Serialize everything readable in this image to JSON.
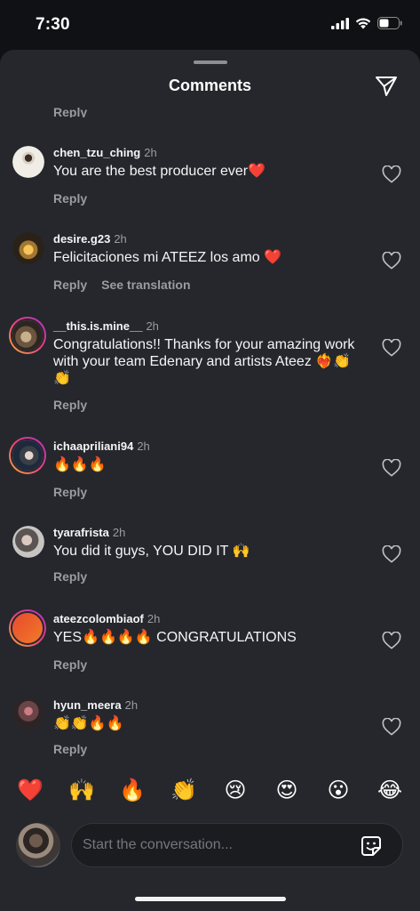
{
  "status": {
    "time": "7:30"
  },
  "header": {
    "title": "Comments"
  },
  "partial_reply": "Reply",
  "comments": [
    {
      "username": "chen_tzu_ching",
      "time": "2h",
      "text": "You are the best producer ever❤️",
      "reply": "Reply",
      "translate": ""
    },
    {
      "username": "desire.g23",
      "time": "2h",
      "text": "Felicitaciones mi ATEEZ los amo ❤️",
      "reply": "Reply",
      "translate": "See translation"
    },
    {
      "username": "__this.is.mine__",
      "time": "2h",
      "text": "Congratulations!! Thanks for your amazing work with your team Edenary and artists Ateez ❤️‍🔥👏👏",
      "reply": "Reply",
      "translate": ""
    },
    {
      "username": "ichaapriliani94",
      "time": "2h",
      "text": "🔥🔥🔥",
      "reply": "Reply",
      "translate": ""
    },
    {
      "username": "tyarafrista",
      "time": "2h",
      "text": "You did it guys, YOU DID IT 🙌",
      "reply": "Reply",
      "translate": ""
    },
    {
      "username": "ateezcolombiaof",
      "time": "2h",
      "text": "YES🔥🔥🔥🔥 CONGRATULATIONS",
      "reply": "Reply",
      "translate": ""
    },
    {
      "username": "hyun_meera",
      "time": "2h",
      "text": "👏👏🔥🔥",
      "reply": "Reply",
      "translate": ""
    }
  ],
  "quick_reactions": [
    "❤️",
    "🙌",
    "🔥",
    "👏",
    "😢",
    "😍",
    "😮",
    "😂"
  ],
  "composer": {
    "placeholder": "Start the conversation..."
  },
  "colors": {
    "sheet": "#25272c",
    "background": "#101114",
    "muted_text": "#9a9ca2",
    "story_ring": "#e8427b"
  }
}
